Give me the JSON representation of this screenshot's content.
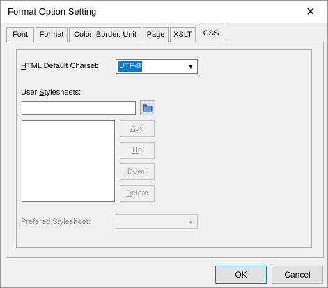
{
  "window": {
    "title": "Format Option Setting",
    "close_glyph": "✕"
  },
  "tabs": [
    {
      "label": "Font",
      "active": false
    },
    {
      "label": "Format",
      "active": false
    },
    {
      "label": "Color, Border, Unit",
      "active": false
    },
    {
      "label": "Page",
      "active": false
    },
    {
      "label": "XSLT",
      "active": false
    },
    {
      "label": "CSS",
      "active": true
    }
  ],
  "css_tab": {
    "charset_label_first": "H",
    "charset_label_rest": "TML Default Charset:",
    "charset_value": "UTF-8",
    "stylesheets_label_before": "User ",
    "stylesheets_label_underlined": "S",
    "stylesheets_label_after": "tylesheets:",
    "stylesheet_path_value": "",
    "buttons": {
      "add_first": "A",
      "add_rest": "dd",
      "up_first": "U",
      "up_rest": "p",
      "down_first": "D",
      "down_rest": "own",
      "delete_first": "D",
      "delete_rest": "elete"
    },
    "preferred_label_first": "P",
    "preferred_label_rest": "refered Stylesheet:",
    "preferred_value": ""
  },
  "footer": {
    "ok_label": "OK",
    "cancel_label": "Cancel"
  },
  "icons": {
    "close": "close-icon",
    "folder": "folder-icon",
    "dropdown": "chevron-down-icon"
  },
  "colors": {
    "selection": "#0078d7",
    "dialog_bg": "#f0f0f0",
    "disabled_text": "#a0a0a0"
  }
}
